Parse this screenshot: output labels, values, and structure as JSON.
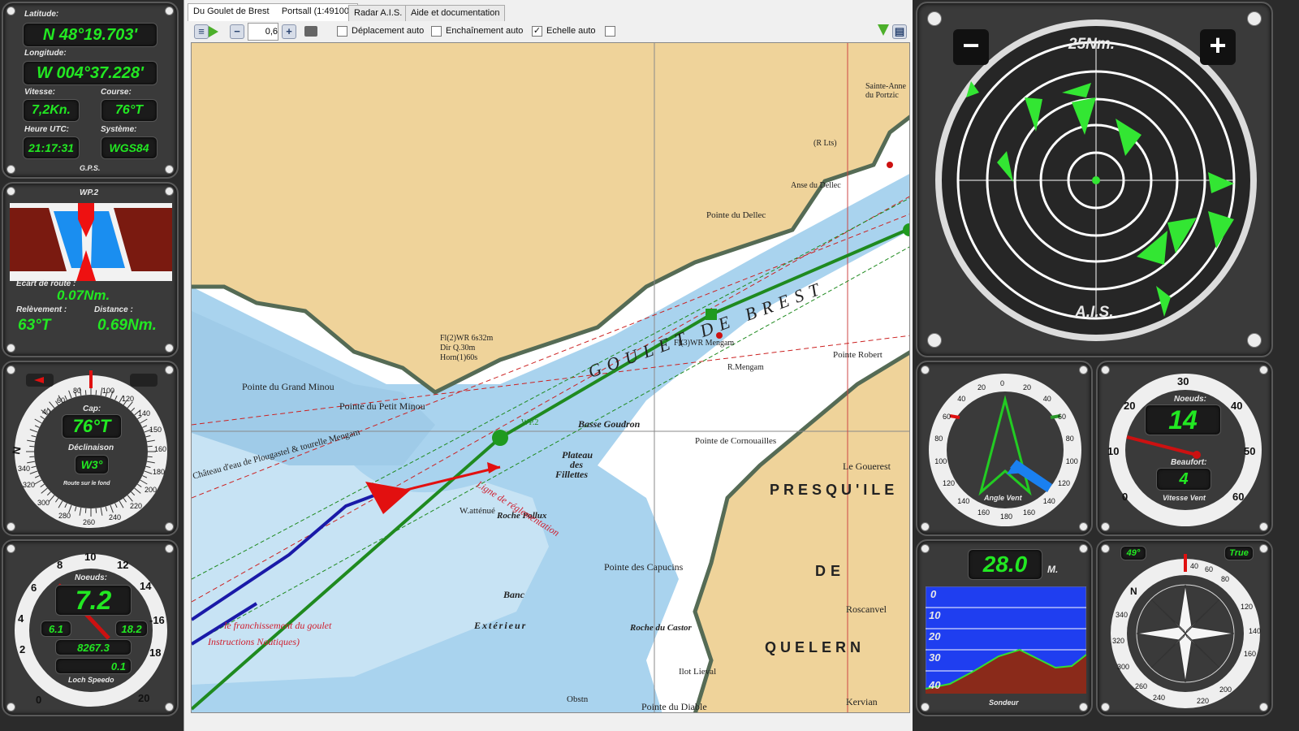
{
  "gps": {
    "latitude_label": "Latitude:",
    "latitude": "N 48°19.703'",
    "longitude_label": "Longitude:",
    "longitude": "W 004°37.228'",
    "speed_label": "Vitesse:",
    "speed": "7,2Kn.",
    "course_label": "Course:",
    "course": "76°T",
    "utc_label": "Heure UTC:",
    "utc": "21:17:31",
    "system_label": "Système:",
    "system": "WGS84",
    "footer": "G.P.S."
  },
  "waypoint": {
    "title": "WP.2",
    "xte_label": "Ecart de route :",
    "xte": "0.07Nm.",
    "bearing_label": "Relèvement :",
    "bearing": "63°T",
    "distance_label": "Distance :",
    "distance": "0.69Nm."
  },
  "compass": {
    "cap_label": "Cap:",
    "cap": "76°T",
    "declination_label": "Déclinaison",
    "declination": "W3°",
    "footer": "Route sur le fond"
  },
  "speedo": {
    "knots_label": "Noeuds:",
    "speed": "7.2",
    "min": "6.1",
    "max": "18.2",
    "log": "8267.3",
    "trip": "0.1",
    "footer": "Loch Speedo"
  },
  "tabs": [
    {
      "label": "Du Goulet de Brest"
    },
    {
      "label": "Portsall (1:49100)"
    },
    {
      "label": "Radar A.I.S."
    },
    {
      "label": "Aide et documentation"
    }
  ],
  "toolbar": {
    "zoom_value": "0,6",
    "deplacement_label": "Déplacement auto",
    "enchainement_label": "Enchaînement auto",
    "echelle_label": "Echelle auto",
    "echelle_checked": "✓"
  },
  "map": {
    "labels": {
      "goulet": "GOULET DE BREST",
      "presquile": "PRESQU'ILE",
      "de": "DE",
      "quelern": "QUELERN",
      "basse_goudron": "Basse Goudron",
      "plateau": "Plateau",
      "des": "des",
      "fillettes": "Fillettes",
      "wp2": "WP.2",
      "pointe_grand_minou": "Pointe du Grand Minou",
      "pointe_petit_minou": "Pointe du Petit Minou",
      "pointe_capucins": "Pointe des Capucins",
      "pointe_cornouailles": "Pointe de Cornouailles",
      "pointe_robert": "Pointe Robert",
      "pointe_dellec": "Pointe du Dellec",
      "anse_dellec": "Anse du Dellec",
      "le_gouerest": "Le Gouerest",
      "roscanvel": "Roscanvel",
      "kervian": "Kervian",
      "pointe_diable": "Pointe du Diable",
      "ilot_lieval": "Ilot Lieval",
      "roche_castor": "Roche du Castor",
      "roche_pollux": "Roche Pollux",
      "banc": "Banc",
      "exterieur": "Extérieur",
      "w_attenue": "W.atténué",
      "r_mengam": "R.Mengam",
      "fl_mengam": "Fl(3)WR Mengam",
      "fl_minou": "Fl(2)WR 6s32m",
      "dir": "Dir Q.30m",
      "horn": "Horn(1)60s",
      "chateau": "Château d'eau de Plougastel & tourelle Mengam",
      "ligne": "Ligne de réglementation",
      "franchissement": "le franchissement du goulet",
      "instructions": "Instructions Nautiques)",
      "sainte_anne": "Sainte-Anne du Portzic",
      "obstn": "Obstn",
      "r_lts": "(R Lts)"
    }
  },
  "radar": {
    "range": "25Nm.",
    "label": "A.I.S.",
    "minus": "−",
    "plus": "+"
  },
  "wind_angle": {
    "footer": "Angle Vent",
    "ticks": [
      "0",
      "20",
      "20",
      "40",
      "40",
      "60",
      "60",
      "80",
      "80",
      "100",
      "100",
      "120",
      "120",
      "140",
      "140",
      "160",
      "160",
      "180"
    ]
  },
  "wind_speed": {
    "knots_label": "Noeuds:",
    "speed": "14",
    "beaufort_label": "Beaufort:",
    "beaufort": "4",
    "footer": "Vitesse Vent",
    "ticks": [
      "0",
      "10",
      "20",
      "30",
      "40",
      "50",
      "60"
    ]
  },
  "depth": {
    "value": "28.0",
    "unit": "M.",
    "scale": [
      "0",
      "10",
      "20",
      "30",
      "40"
    ],
    "footer": "Sondeur",
    "colors": {
      "water": "#1f3ef0",
      "seabed": "#8a2a1a"
    }
  },
  "compass_rose": {
    "heading": "49°",
    "mode": "True"
  },
  "colors": {
    "lcd_green": "#22e822",
    "route_green": "#1f8a1f",
    "track_blue": "#1a1aa8",
    "ais_green": "#33e633",
    "land": "#efd39a",
    "shallow": "#9fcbe8",
    "water": "#ffffff"
  }
}
